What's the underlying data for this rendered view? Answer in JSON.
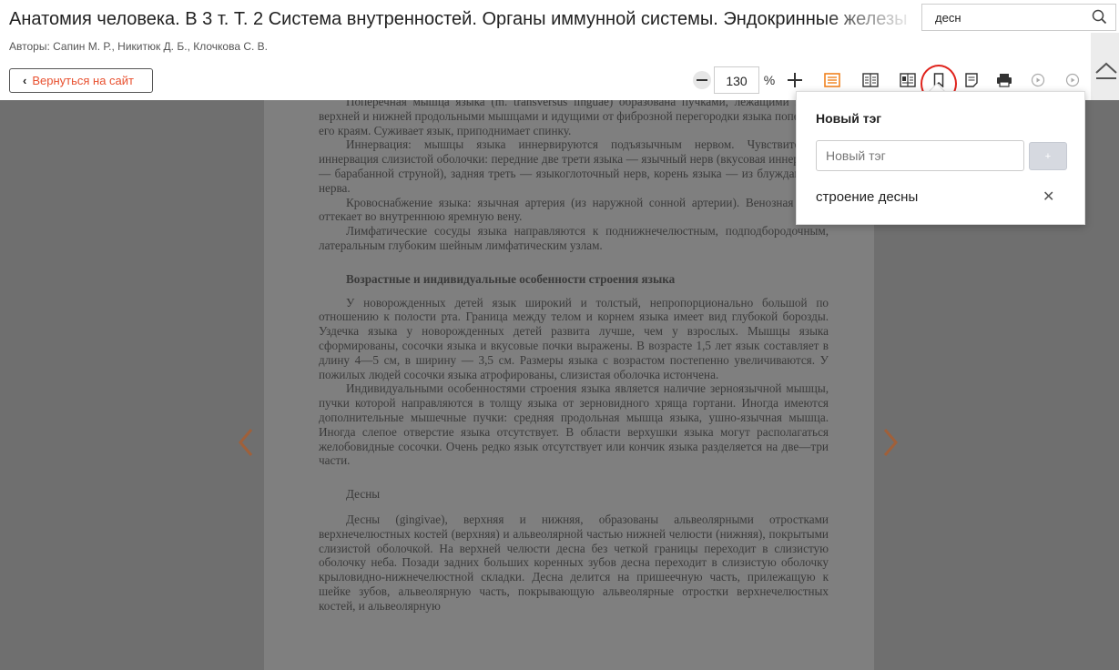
{
  "header": {
    "title": "Анатомия человека. В 3 т. Т. 2 Система внутренностей. Органы иммунной системы. Эндокринные железы",
    "authors": "Авторы: Сапин М. Р., Никитюк Д. Б., Клочкова С. В.",
    "back_label": "Вернуться на сайт"
  },
  "search": {
    "value": "десн"
  },
  "toolbar": {
    "zoom_value": "130",
    "zoom_unit": "%",
    "accent_color": "#f0821e",
    "icons": [
      "zoom-out-icon",
      "zoom-in-icon",
      "single-page-icon",
      "two-page-icon",
      "two-page-cover-icon",
      "bookmark-icon",
      "notes-icon",
      "print-icon",
      "play-icon",
      "play-next-icon",
      "scroll-up-icon"
    ]
  },
  "popup": {
    "title": "Новый тэг",
    "input_placeholder": "Новый тэг",
    "add_label": "+",
    "tag": "строение десны"
  },
  "book": {
    "p1": "Поперечная мышца языка (m. transversus linguae) образована пучками, лежащими между верхней и нижней продольными мышцами и идущими от фиброзной перегородки языка поперечно его краям. Суживает язык, приподнимает спинку.",
    "p2": "Иннервация: мышцы языка иннервируются подъязычным нервом. Чувствительная иннервация слизистой оболочки: передние две трети языка — язычный нерв (вкусовая иннервация — барабанной струной), задняя треть — языкоглоточный нерв, корень языка — из блуждающего нерва.",
    "p3": "Кровоснабжение языка: язычная артерия (из наружной сонной артерии). Венозная кровь оттекает во внутреннюю яремную вену.",
    "p4": "Лимфатические сосуды языка направляются к поднижнечелюстным, подподбородочным, латеральным глубоким шейным лимфатическим узлам.",
    "h1": "Возрастные и индивидуальные особенности строения языка",
    "p5": "У новорожденных детей язык широкий и толстый, непропорционально большой по отношению к полости рта. Граница между телом и корнем языка имеет вид глубокой борозды. Уздечка языка у новорожденных детей развита лучше, чем у взрослых. Мышцы языка сформированы, сосочки языка и вкусовые почки выражены. В возрасте 1,5 лет язык составляет в длину 4—5 см, в ширину — 3,5 см. Размеры языка с возрастом постепенно увеличиваются. У пожилых людей сосочки языка атрофированы, слизистая оболочка истончена.",
    "p6": "Индивидуальными особенностями строения языка является наличие зерноязычной мышцы, пучки которой направляются в толщу языка от зерновидного хряща гортани. Иногда имеются дополнительные мышечные пучки: средняя продольная мышца языка, ушно-язычная мышца. Иногда слепое отверстие языка отсутствует. В области верхушки языка могут располагаться желобовидные сосочки. Очень редко язык отсутствует или кончик языка разделяется на две—три части.",
    "h2": "Десны",
    "p7": "Десны (gingivae), верхняя и нижняя, образованы альвеолярными отростками верхнечелюстных костей (верхняя) и альвеолярной частью нижней челюсти (нижняя), покрытыми слизистой оболочкой. На верхней челюсти десна без четкой границы переходит в слизистую оболочку неба. Позади задних больших коренных зубов десна переходит в слизистую оболочку крыловидно-нижнечелюстной складки. Десна делится на пришеечную часть, прилежащую к шейке зубов, альвеолярную часть, покрывающую альвеолярные отростки верхнечелюстных костей, и альвеолярную"
  }
}
